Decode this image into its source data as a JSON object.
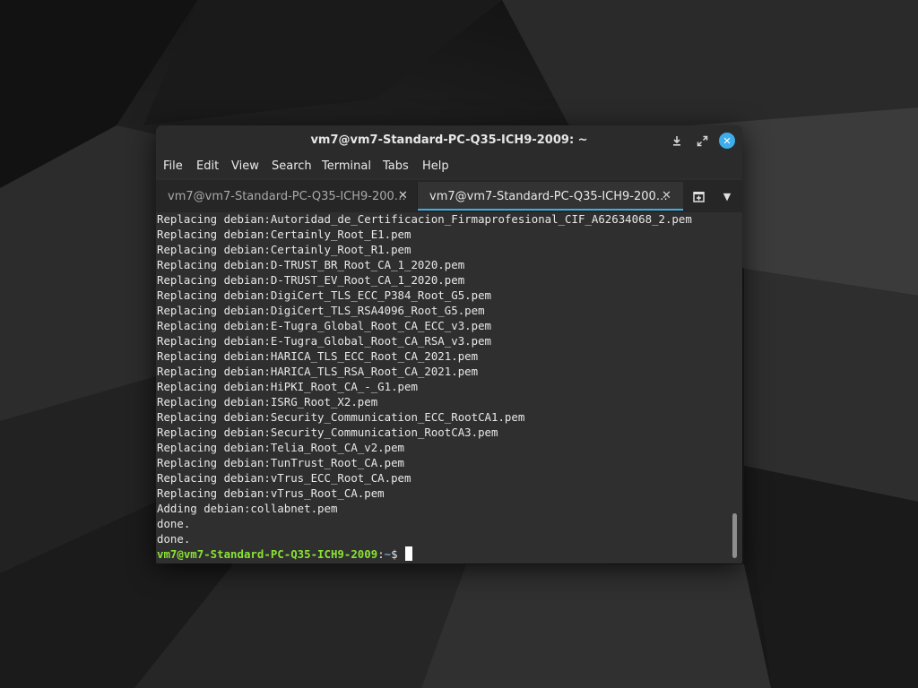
{
  "window": {
    "title": "vm7@vm7-Standard-PC-Q35-ICH9-2009: ~"
  },
  "menu": [
    "File",
    "Edit",
    "View",
    "Search",
    "Terminal",
    "Tabs",
    "Help"
  ],
  "tabs": [
    {
      "label": "vm7@vm7-Standard-PC-Q35-ICH9-200…",
      "active": false
    },
    {
      "label": "vm7@vm7-Standard-PC-Q35-ICH9-200…",
      "active": true
    }
  ],
  "terminal": {
    "lines": [
      "Replacing debian:Autoridad_de_Certificacion_Firmaprofesional_CIF_A62634068_2.pem",
      "Replacing debian:Certainly_Root_E1.pem",
      "Replacing debian:Certainly_Root_R1.pem",
      "Replacing debian:D-TRUST_BR_Root_CA_1_2020.pem",
      "Replacing debian:D-TRUST_EV_Root_CA_1_2020.pem",
      "Replacing debian:DigiCert_TLS_ECC_P384_Root_G5.pem",
      "Replacing debian:DigiCert_TLS_RSA4096_Root_G5.pem",
      "Replacing debian:E-Tugra_Global_Root_CA_ECC_v3.pem",
      "Replacing debian:E-Tugra_Global_Root_CA_RSA_v3.pem",
      "Replacing debian:HARICA_TLS_ECC_Root_CA_2021.pem",
      "Replacing debian:HARICA_TLS_RSA_Root_CA_2021.pem",
      "Replacing debian:HiPKI_Root_CA_-_G1.pem",
      "Replacing debian:ISRG_Root_X2.pem",
      "Replacing debian:Security_Communication_ECC_RootCA1.pem",
      "Replacing debian:Security_Communication_RootCA3.pem",
      "Replacing debian:Telia_Root_CA_v2.pem",
      "Replacing debian:TunTrust_Root_CA.pem",
      "Replacing debian:vTrus_ECC_Root_CA.pem",
      "Replacing debian:vTrus_Root_CA.pem",
      "Adding debian:collabnet.pem",
      "done.",
      "done."
    ],
    "prompt_user": "vm7@vm7-Standard-PC-Q35-ICH9-2009",
    "prompt_sep": ":",
    "prompt_path": "~",
    "prompt_symbol": "$"
  },
  "icons": {
    "download": "download-icon",
    "maximize": "maximize-icon",
    "close": "close-icon",
    "tab_close": "close-icon",
    "new_tab": "new-tab-icon",
    "tab_menu": "chevron-down-icon"
  },
  "colors": {
    "accent": "#3daee9",
    "prompt_user": "#8ae234",
    "prompt_path": "#729fcf",
    "terminal_bg": "#2f2f2f",
    "terminal_fg": "#e8e8e8"
  }
}
